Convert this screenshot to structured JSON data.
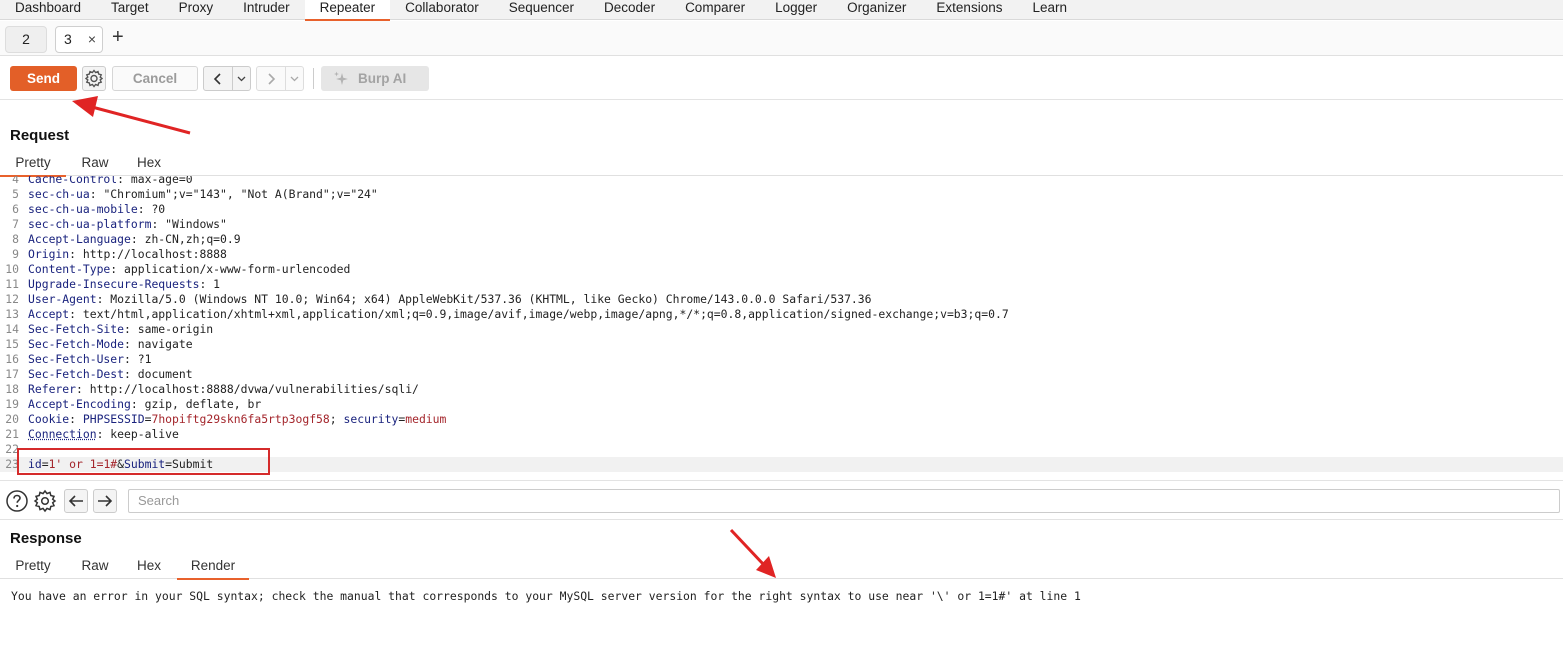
{
  "topnav": {
    "tabs": [
      "Dashboard",
      "Target",
      "Proxy",
      "Intruder",
      "Repeater",
      "Collaborator",
      "Sequencer",
      "Decoder",
      "Comparer",
      "Logger",
      "Organizer",
      "Extensions",
      "Learn"
    ],
    "active": "Repeater"
  },
  "subtabs": {
    "tab2": "2",
    "tab3": "3",
    "close": "×",
    "add": "+"
  },
  "toolbar": {
    "send": "Send",
    "cancel": "Cancel",
    "burp_ai": "Burp AI"
  },
  "request": {
    "title": "Request",
    "tabs": [
      "Pretty",
      "Raw",
      "Hex"
    ],
    "active_tab": "Pretty",
    "lines": [
      {
        "n": "4",
        "k": "Cache-Control",
        "v": "max-age=0"
      },
      {
        "n": "5",
        "k": "sec-ch-ua",
        "v": "\"Chromium\";v=\"143\", \"Not A(Brand\";v=\"24\""
      },
      {
        "n": "6",
        "k": "sec-ch-ua-mobile",
        "v": "?0"
      },
      {
        "n": "7",
        "k": "sec-ch-ua-platform",
        "v": "\"Windows\""
      },
      {
        "n": "8",
        "k": "Accept-Language",
        "v": "zh-CN,zh;q=0.9"
      },
      {
        "n": "9",
        "k": "Origin",
        "v": "http://localhost:8888"
      },
      {
        "n": "10",
        "k": "Content-Type",
        "v": "application/x-www-form-urlencoded"
      },
      {
        "n": "11",
        "k": "Upgrade-Insecure-Requests",
        "v": "1"
      },
      {
        "n": "12",
        "k": "User-Agent",
        "v": "Mozilla/5.0 (Windows NT 10.0; Win64; x64) AppleWebKit/537.36 (KHTML, like Gecko) Chrome/143.0.0.0 Safari/537.36"
      },
      {
        "n": "13",
        "k": "Accept",
        "v": "text/html,application/xhtml+xml,application/xml;q=0.9,image/avif,image/webp,image/apng,*/*;q=0.8,application/signed-exchange;v=b3;q=0.7"
      },
      {
        "n": "14",
        "k": "Sec-Fetch-Site",
        "v": "same-origin"
      },
      {
        "n": "15",
        "k": "Sec-Fetch-Mode",
        "v": "navigate"
      },
      {
        "n": "16",
        "k": "Sec-Fetch-User",
        "v": "?1"
      },
      {
        "n": "17",
        "k": "Sec-Fetch-Dest",
        "v": "document"
      },
      {
        "n": "18",
        "k": "Referer",
        "v": "http://localhost:8888/dvwa/vulnerabilities/sqli/"
      },
      {
        "n": "19",
        "k": "Accept-Encoding",
        "v": "gzip, deflate, br"
      },
      {
        "n": "20",
        "k": "Cookie",
        "cookie": [
          [
            "PHPSESSID",
            "7hopiftg29skn6fa5rtp3ogf58"
          ],
          [
            "security",
            "medium"
          ]
        ]
      },
      {
        "n": "21",
        "k": "Connection",
        "v": "keep-alive"
      },
      {
        "n": "22",
        "k": "",
        "v": ""
      },
      {
        "n": "23",
        "body": {
          "param1": "id",
          "value1": "1' or 1=1#",
          "param2": "Submit",
          "value2": "Submit"
        }
      }
    ]
  },
  "search": {
    "placeholder": "Search"
  },
  "response": {
    "title": "Response",
    "tabs": [
      "Pretty",
      "Raw",
      "Hex",
      "Render"
    ],
    "active_tab": "Render",
    "body": "You have an error in your SQL syntax; check the manual that corresponds to your MySQL server version for the right syntax to use near '\\' or 1=1#' at line 1"
  },
  "colors": {
    "accent": "#e35f28",
    "annotation": "#d52b2b",
    "header_key": "#1a237e",
    "cookie_value": "#a4262c"
  }
}
